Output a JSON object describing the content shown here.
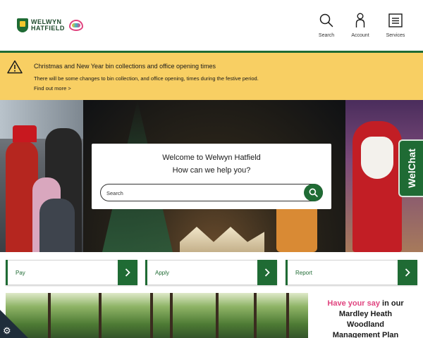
{
  "header": {
    "logo": {
      "line1": "WELWYN",
      "line2": "HATFIELD"
    },
    "nav": [
      {
        "label": "Search",
        "icon": "search-icon"
      },
      {
        "label": "Account",
        "icon": "account-icon"
      },
      {
        "label": "Services",
        "icon": "services-icon"
      }
    ]
  },
  "alert": {
    "icon": "warning-icon",
    "title": "Christmas and New Year bin collections and office opening times",
    "text": "There will be some changes to bin collection, and office opening, times during the festive period.",
    "link": "Find out more >"
  },
  "hero": {
    "welcome_line1": "Welcome to Welwyn Hatfield",
    "welcome_line2": "How can we help you?",
    "search_placeholder": "Search"
  },
  "welchat": {
    "label": "WelChat"
  },
  "quick_links": [
    {
      "label": "Pay",
      "icon": "chevron-right-icon"
    },
    {
      "label": "Apply",
      "icon": "chevron-right-icon"
    },
    {
      "label": "Report",
      "icon": "chevron-right-icon"
    }
  ],
  "promo": {
    "highlight": "Have your say",
    "rest_line1": " in our",
    "line2": "Mardley Heath",
    "line3": "Woodland",
    "line4": "Management Plan"
  },
  "colors": {
    "brand_green": "#1f6b34",
    "alert_yellow": "#f8cf63",
    "promo_pink": "#e0447f"
  }
}
